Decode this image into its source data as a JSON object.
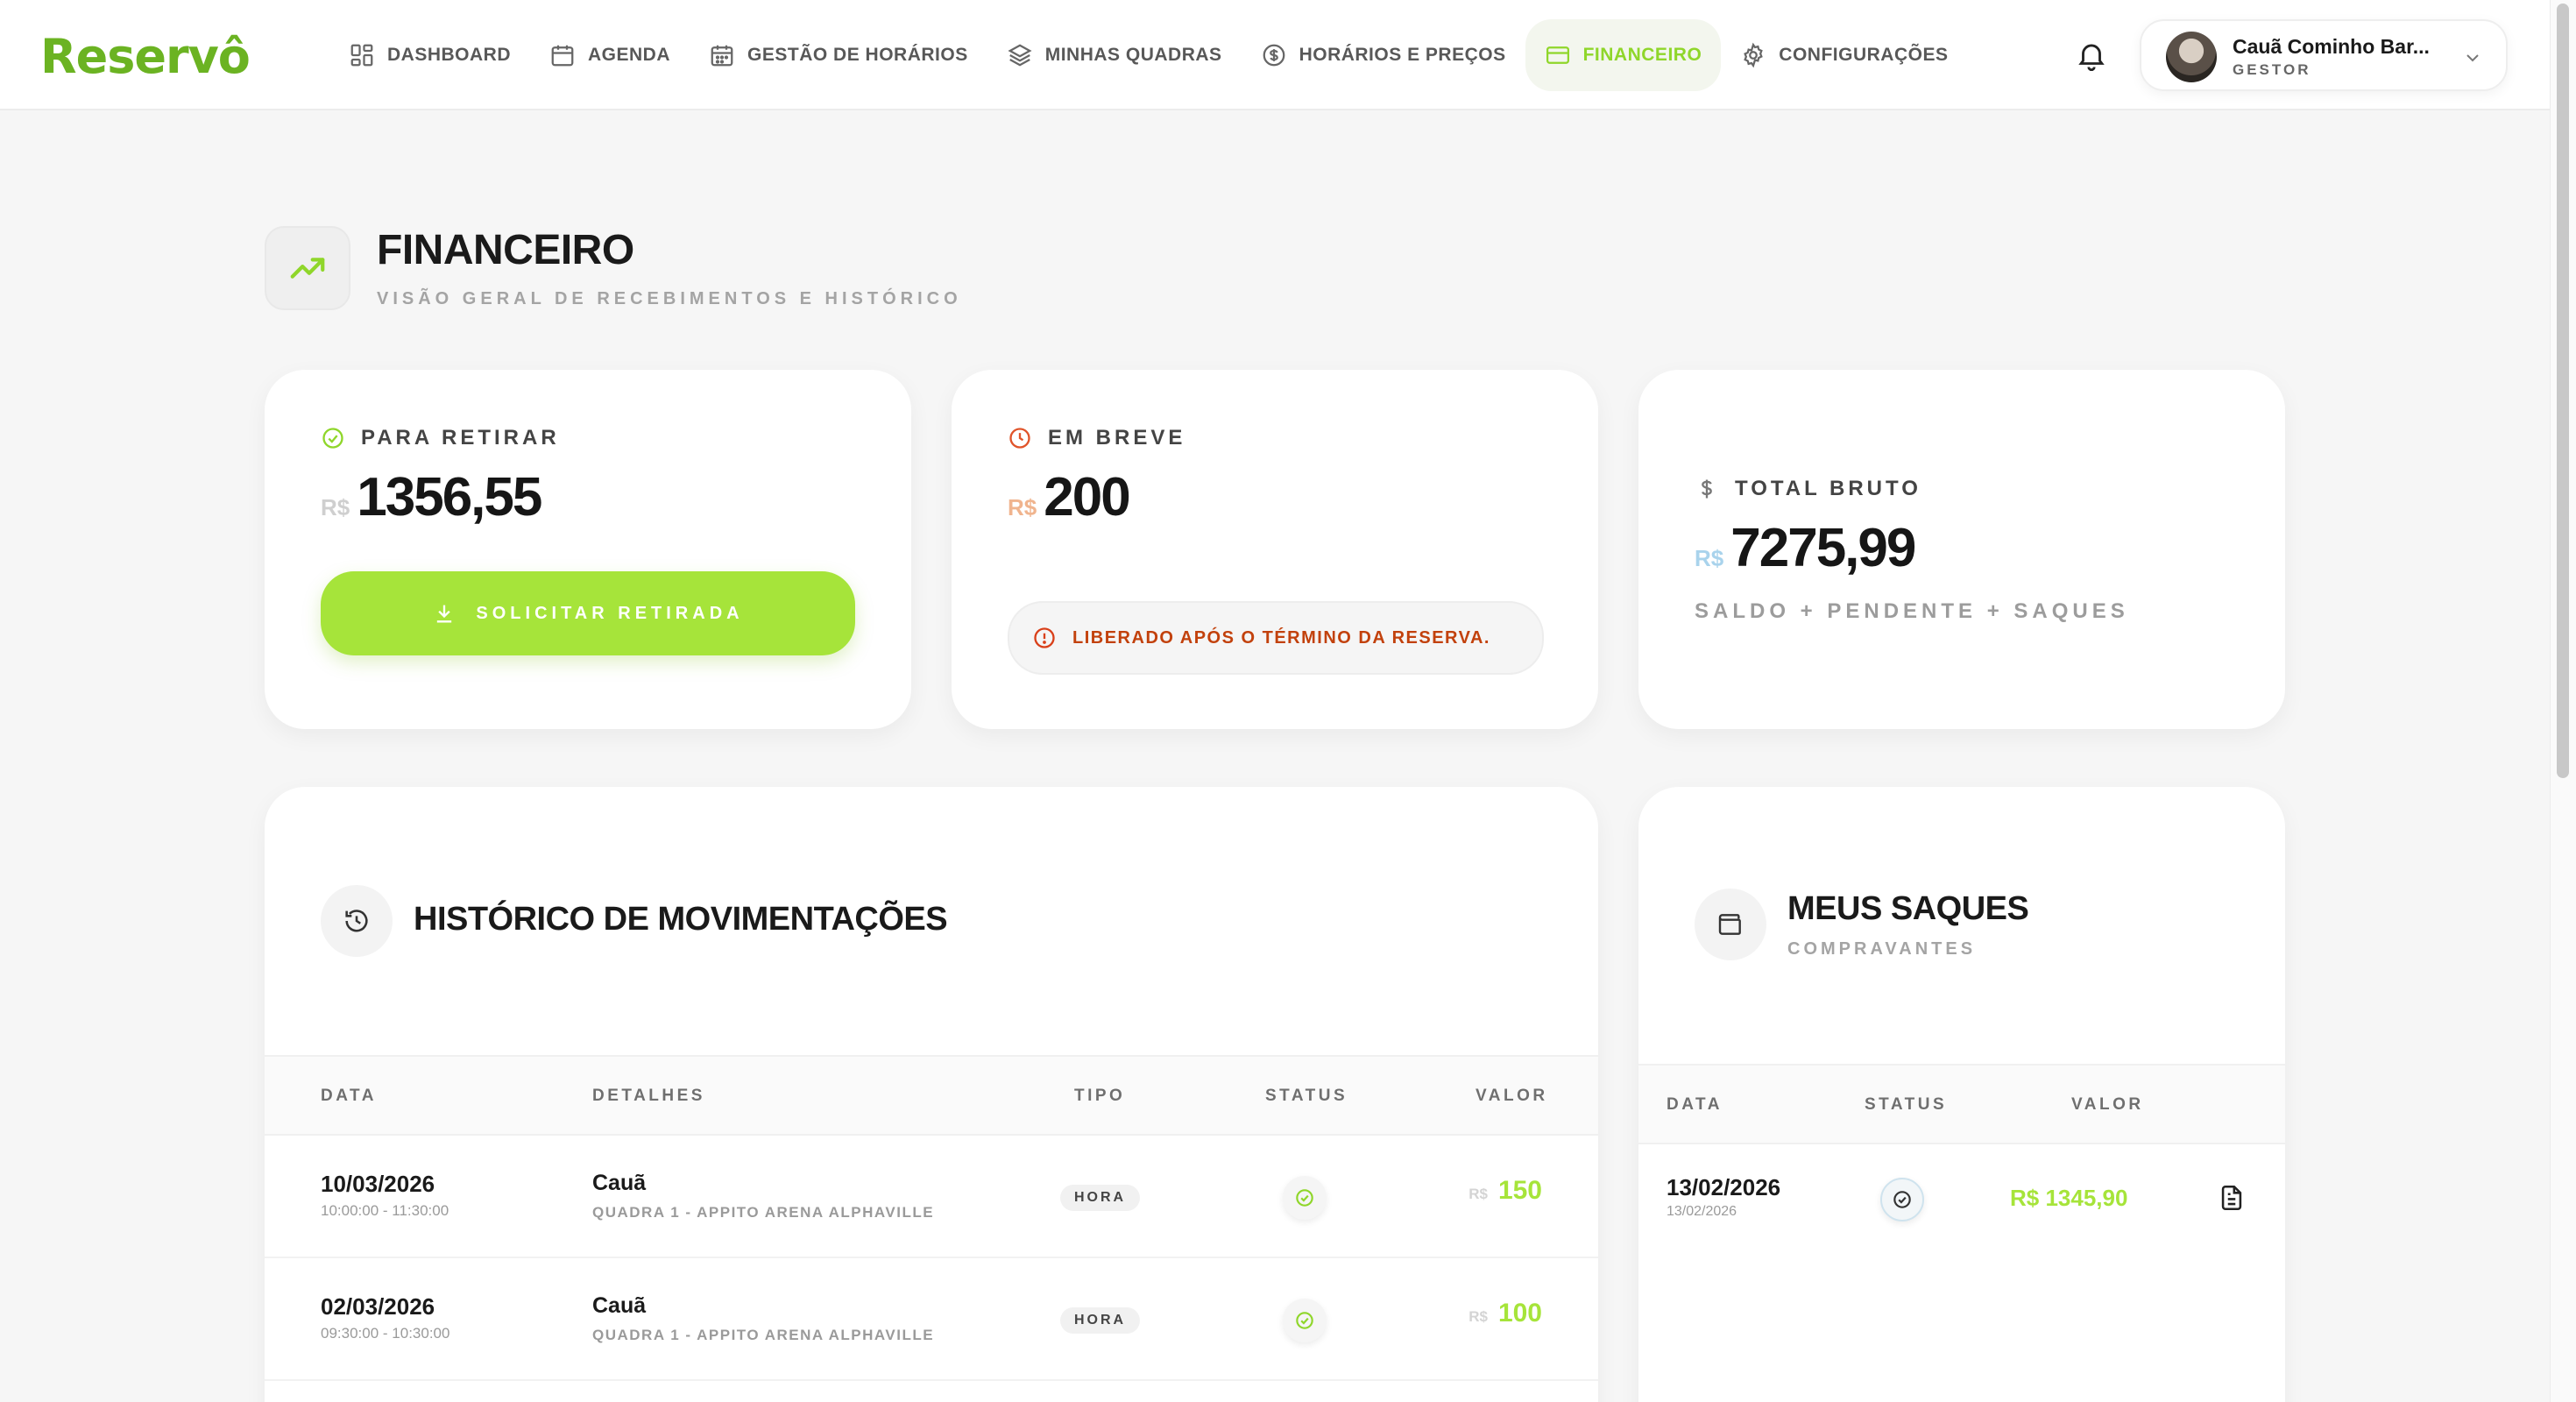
{
  "brand": {
    "name": "Reservô",
    "accent": "#a6e43a",
    "brand_green": "#6bb322"
  },
  "nav": {
    "items": [
      {
        "label": "DASHBOARD",
        "icon": "grid-icon"
      },
      {
        "label": "AGENDA",
        "icon": "calendar-icon"
      },
      {
        "label": "GESTÃO DE HORÁRIOS",
        "icon": "calendar-grid-icon"
      },
      {
        "label": "MINHAS QUADRAS",
        "icon": "layers-icon"
      },
      {
        "label": "HORÁRIOS E PREÇOS",
        "icon": "dollar-circle-icon"
      },
      {
        "label": "FINANCEIRO",
        "icon": "credit-card-icon",
        "active": true
      },
      {
        "label": "CONFIGURAÇÕES",
        "icon": "gear-icon"
      }
    ]
  },
  "user": {
    "name": "Cauã Cominho Bar...",
    "role": "GESTOR"
  },
  "header": {
    "title": "FINANCEIRO",
    "subtitle": "VISÃO GERAL DE RECEBIMENTOS E HISTÓRICO"
  },
  "cards": {
    "available": {
      "label": "PARA RETIRAR",
      "currency": "R$",
      "amount": "1356,55",
      "button": "SOLICITAR RETIRADA"
    },
    "soon": {
      "label": "EM BREVE",
      "currency": "R$",
      "amount": "200",
      "note": "LIBERADO APÓS O TÉRMINO DA RESERVA."
    },
    "gross": {
      "label": "TOTAL BRUTO",
      "currency": "R$",
      "amount": "7275,99",
      "subtitle": "SALDO + PENDENTE + SAQUES"
    }
  },
  "history": {
    "title": "HISTÓRICO DE MOVIMENTAÇÕES",
    "columns": {
      "date": "DATA",
      "details": "DETALHES",
      "type": "TIPO",
      "status": "STATUS",
      "value": "VALOR"
    },
    "rows": [
      {
        "date": "10/03/2026",
        "time": "10:00:00 - 11:30:00",
        "name": "Cauã",
        "place": "QUADRA 1 - APPITO ARENA ALPHAVILLE",
        "type": "HORA",
        "status": "completed",
        "currency": "R$",
        "value": "150"
      },
      {
        "date": "02/03/2026",
        "time": "09:30:00 - 10:30:00",
        "name": "Cauã",
        "place": "QUADRA 1 - APPITO ARENA ALPHAVILLE",
        "type": "HORA",
        "status": "completed",
        "currency": "R$",
        "value": "100"
      }
    ]
  },
  "withdrawals": {
    "title": "MEUS SAQUES",
    "subtitle": "COMPRAVANTES",
    "columns": {
      "date": "DATA",
      "status": "STATUS",
      "value": "VALOR"
    },
    "rows": [
      {
        "date": "13/02/2026",
        "date_small": "13/02/2026",
        "status": "pending",
        "value": "R$ 1345,90"
      }
    ]
  }
}
